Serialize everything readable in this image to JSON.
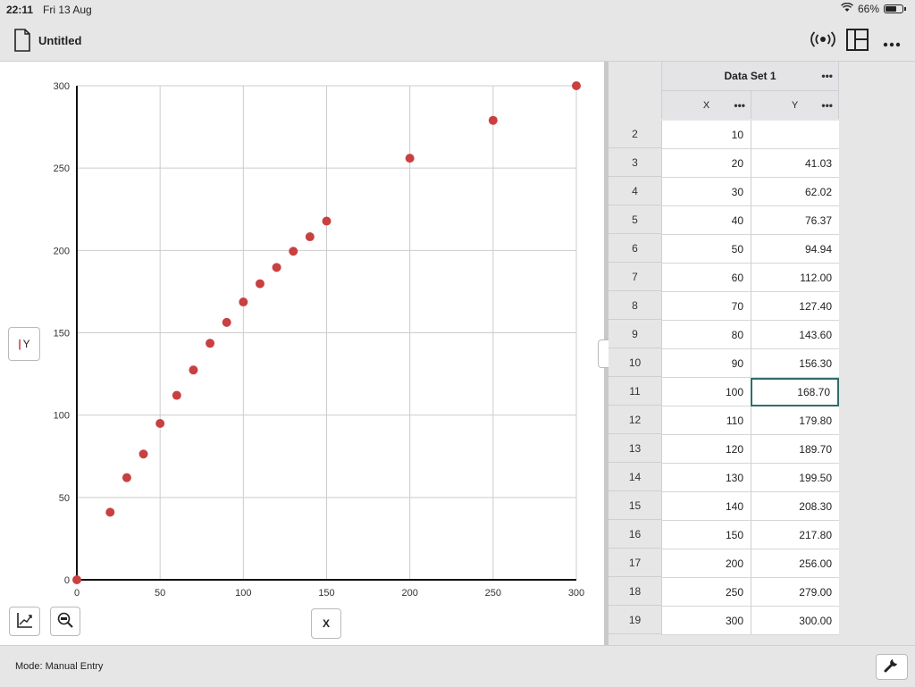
{
  "status_bar": {
    "time": "22:11",
    "date": "Fri 13 Aug",
    "battery": "66%",
    "battery_level": 0.66
  },
  "header": {
    "title": "Untitled",
    "icons": [
      "document-icon",
      "broadcast-icon",
      "layout-icon",
      "more-icon"
    ]
  },
  "graph": {
    "y_axis_button": "Y",
    "x_axis_button": "X",
    "tool_icons": [
      "graph-options-icon",
      "zoom-out-icon"
    ]
  },
  "chart_data": {
    "type": "scatter",
    "xlim": [
      0,
      300
    ],
    "ylim": [
      0,
      300
    ],
    "x_ticks": [
      0,
      50,
      100,
      150,
      200,
      250,
      300
    ],
    "y_ticks": [
      0,
      50,
      100,
      150,
      200,
      250,
      300
    ],
    "grid": true,
    "point_color": "#c94040",
    "points": [
      [
        0,
        0
      ],
      [
        20,
        41.03
      ],
      [
        30,
        62.02
      ],
      [
        40,
        76.37
      ],
      [
        50,
        94.94
      ],
      [
        60,
        112.0
      ],
      [
        70,
        127.4
      ],
      [
        80,
        143.6
      ],
      [
        90,
        156.3
      ],
      [
        100,
        168.7
      ],
      [
        110,
        179.8
      ],
      [
        120,
        189.7
      ],
      [
        130,
        199.5
      ],
      [
        140,
        208.3
      ],
      [
        150,
        217.8
      ],
      [
        200,
        256.0
      ],
      [
        250,
        279.0
      ],
      [
        300,
        300.0
      ]
    ]
  },
  "table": {
    "dataset_title": "Data Set 1",
    "columns": [
      "X",
      "Y"
    ],
    "selected_row": "11",
    "rows": [
      {
        "num": "2",
        "x": "10",
        "y": ""
      },
      {
        "num": "3",
        "x": "20",
        "y": "41.03"
      },
      {
        "num": "4",
        "x": "30",
        "y": "62.02"
      },
      {
        "num": "5",
        "x": "40",
        "y": "76.37"
      },
      {
        "num": "6",
        "x": "50",
        "y": "94.94"
      },
      {
        "num": "7",
        "x": "60",
        "y": "112.00"
      },
      {
        "num": "8",
        "x": "70",
        "y": "127.40"
      },
      {
        "num": "9",
        "x": "80",
        "y": "143.60"
      },
      {
        "num": "10",
        "x": "90",
        "y": "156.30"
      },
      {
        "num": "11",
        "x": "100",
        "y": "168.70"
      },
      {
        "num": "12",
        "x": "110",
        "y": "179.80"
      },
      {
        "num": "13",
        "x": "120",
        "y": "189.70"
      },
      {
        "num": "14",
        "x": "130",
        "y": "199.50"
      },
      {
        "num": "15",
        "x": "140",
        "y": "208.30"
      },
      {
        "num": "16",
        "x": "150",
        "y": "217.80"
      },
      {
        "num": "17",
        "x": "200",
        "y": "256.00"
      },
      {
        "num": "18",
        "x": "250",
        "y": "279.00"
      },
      {
        "num": "19",
        "x": "300",
        "y": "300.00"
      }
    ]
  },
  "footer": {
    "mode": "Mode: Manual Entry",
    "tools_icon": "wrench-icon"
  }
}
